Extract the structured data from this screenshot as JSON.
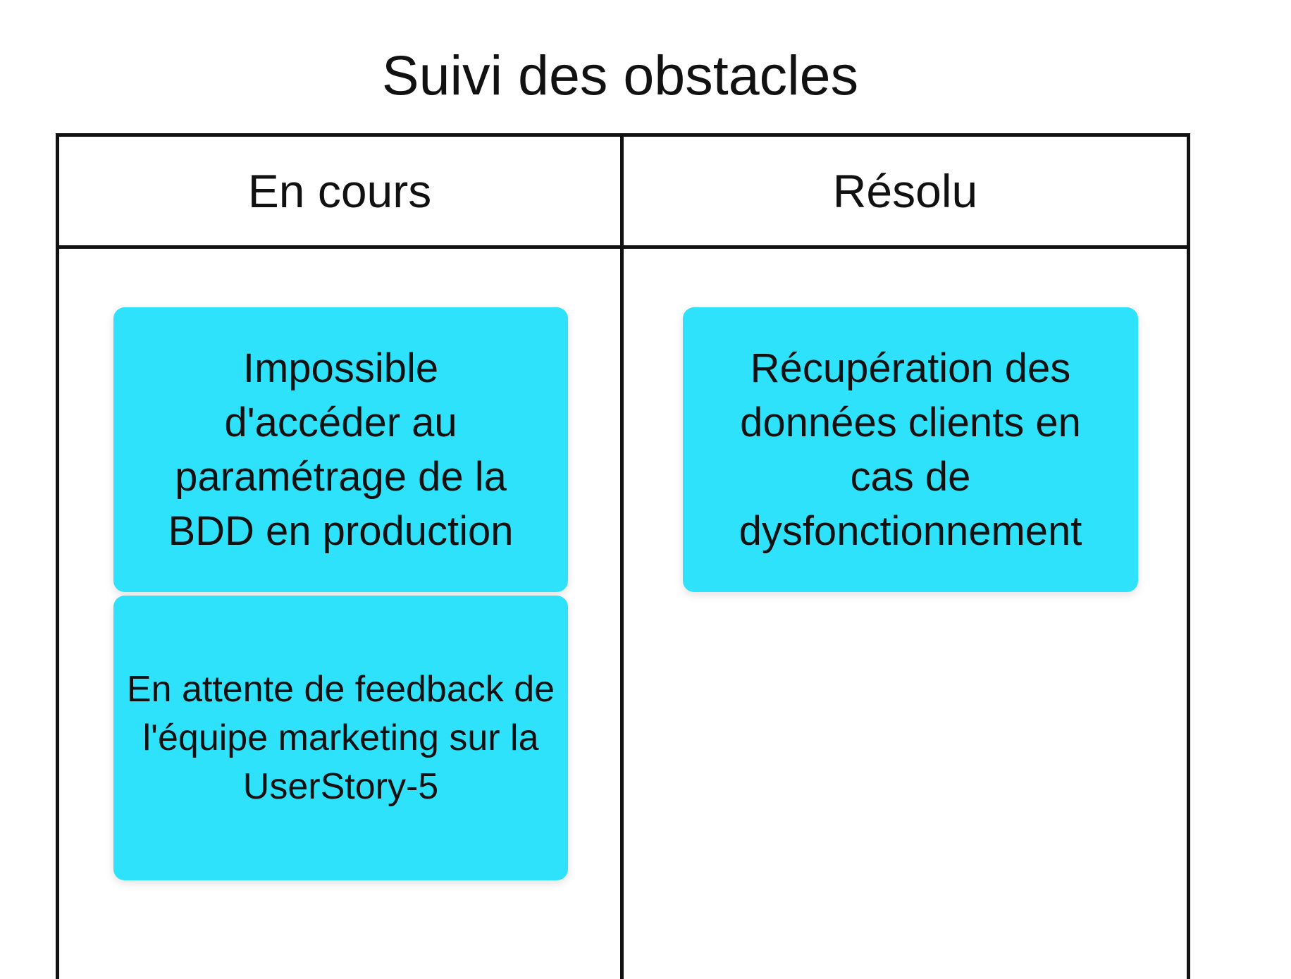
{
  "title": "Suivi des obstacles",
  "columns": [
    {
      "label": "En cours",
      "cards": [
        {
          "text": "Impossible d'accéder au paramétrage de la BDD en production"
        },
        {
          "text": "En attente de feedback de l'équipe marketing sur la UserStory-5"
        }
      ]
    },
    {
      "label": "Résolu",
      "cards": [
        {
          "text": "Récupération des données clients en cas de dysfonctionnement"
        }
      ]
    }
  ],
  "colors": {
    "card_background": "#2ee2fc",
    "line": "#111111",
    "text": "#111111",
    "background": "#ffffff"
  }
}
